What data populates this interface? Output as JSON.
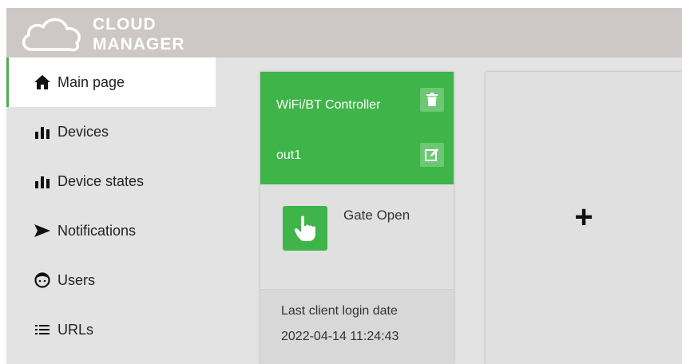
{
  "app": {
    "logo_line1": "CLOUD",
    "logo_line2": "MANAGER"
  },
  "sidebar": {
    "items": [
      {
        "label": "Main page",
        "icon": "home-icon",
        "active": true
      },
      {
        "label": "Devices",
        "icon": "bar-chart-icon"
      },
      {
        "label": "Device states",
        "icon": "bar-chart-icon"
      },
      {
        "label": "Notifications",
        "icon": "send-icon"
      },
      {
        "label": "Users",
        "icon": "user-face-icon"
      },
      {
        "label": "URLs",
        "icon": "list-icon"
      }
    ]
  },
  "device_card": {
    "name": "WiFi/BT Controller",
    "output": "out1",
    "action_label": "Gate Open",
    "footer_label": "Last client login date",
    "footer_date": "2022-04-14 11:24:43",
    "icons": {
      "delete": "trash-icon",
      "edit": "edit-icon",
      "action": "hand-pointer-icon"
    }
  },
  "add_card": {
    "symbol": "+"
  },
  "colors": {
    "accent_green": "#3fb449",
    "topbar": "#cdc8c5",
    "sidebar": "#e3e3e3"
  }
}
